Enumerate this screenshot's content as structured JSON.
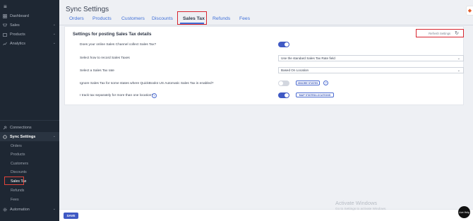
{
  "sidebar": {
    "brand": "≡",
    "items": [
      {
        "label": "Dashboard",
        "icon": "dashboard-icon"
      },
      {
        "label": "Sales",
        "icon": "sales-icon"
      },
      {
        "label": "Products",
        "icon": "products-icon"
      },
      {
        "label": "Analytics",
        "icon": "analytics-icon"
      }
    ],
    "connections": "Connections",
    "sync_settings": "Sync Settings",
    "sub_items": [
      "Orders",
      "Products",
      "Customers",
      "Discounts",
      "Sales Tax",
      "Refunds",
      "Fees"
    ],
    "automation": "Automation",
    "chevron": "⌄"
  },
  "page": {
    "title": "Sync Settings",
    "tabs": [
      "Orders",
      "Products",
      "Customers",
      "Discounts",
      "Sales Tax",
      "Refunds",
      "Fees"
    ],
    "active_tab": "Sales Tax"
  },
  "card": {
    "title": "Settings for posting Sales Tax details",
    "refresh_label": "Refresh Settings",
    "rows": [
      {
        "label": "Does your online Sales Channel collect Sales Tax?",
        "toggle": "on"
      },
      {
        "label": "Select how to record Sales Taxes",
        "select": "Use the standard Sales Tax Rate field"
      },
      {
        "label": "Select a Sales Tax rate",
        "select": "Based On Location"
      },
      {
        "label": "Ignore Sales Tax for some states where QuickBooks US Automatic Sales Tax is enabled?",
        "toggle": "off",
        "button": "IGNORE STATES"
      },
      {
        "label": "I track tax separately for more than one location?",
        "toggle": "on",
        "button": "MAP STATES/LOCATIONS"
      }
    ]
  },
  "footer": {
    "save_label": "SAVE"
  },
  "watermark": {
    "title": "Activate Windows",
    "subtitle": "Go to Settings to activate Windows."
  },
  "chat": {
    "label": "Live Help"
  },
  "colors": {
    "accent": "#3f59c4",
    "highlight": "#d72630",
    "sidebar": "#1e2733"
  }
}
